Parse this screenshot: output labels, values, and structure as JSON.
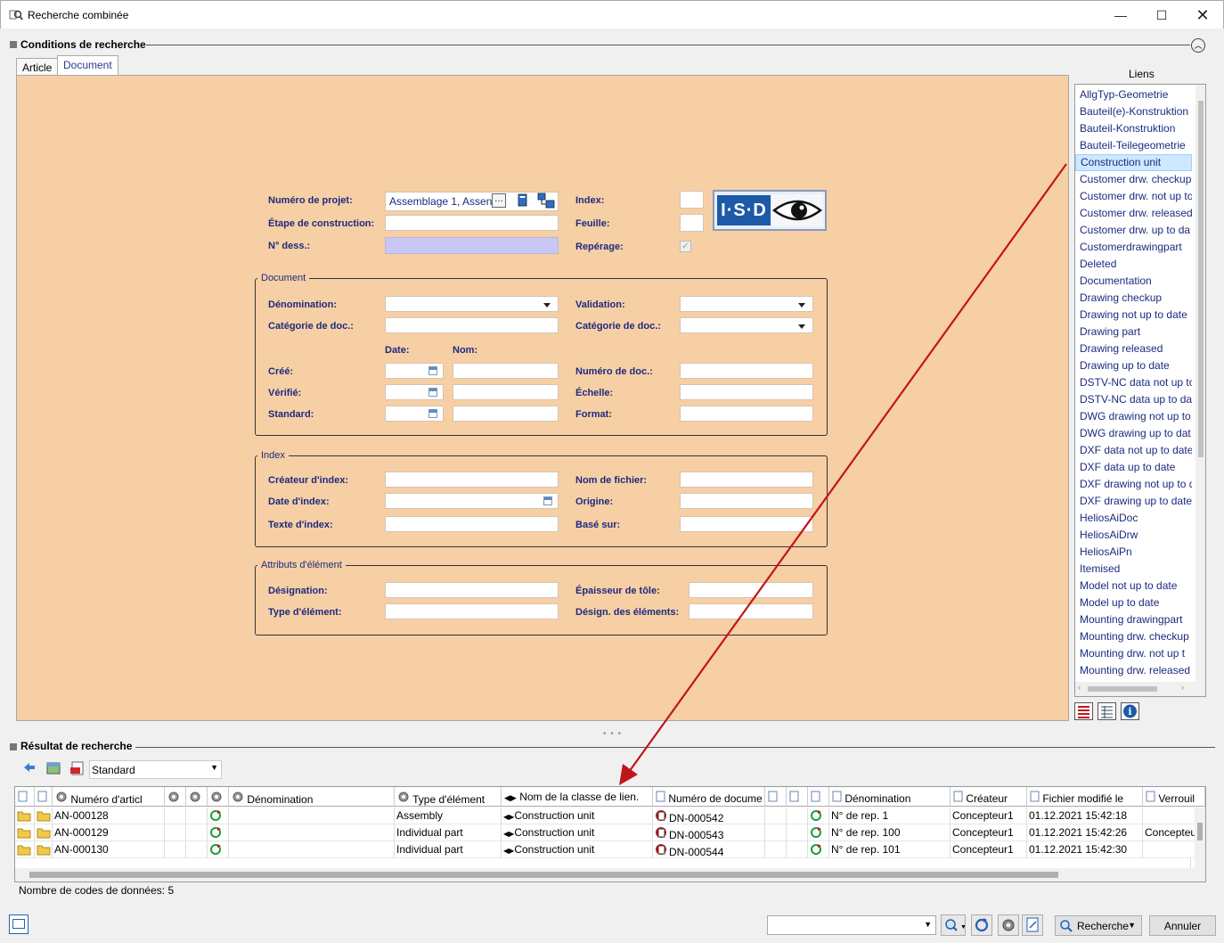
{
  "window": {
    "title": "Recherche combinée"
  },
  "search": {
    "section_title": "Conditions de recherche",
    "tabs": [
      "Article",
      "Document"
    ],
    "fields": {
      "project_label": "Numéro de projet:",
      "project_value": "Assemblage 1, Assen",
      "stage_label": "Étape de construction:",
      "drawing_no_label": "N° dess.:",
      "index_label": "Index:",
      "sheet_label": "Feuille:",
      "marking_label": "Repérage:"
    },
    "logo": "I·S·D",
    "doc_group": {
      "title": "Document",
      "denomination": "Dénomination:",
      "category": "Catégorie de doc.:",
      "validation": "Validation:",
      "category2": "Catégorie de doc.:",
      "date_hdr": "Date:",
      "name_hdr": "Nom:",
      "created": "Créé:",
      "checked": "Vérifié:",
      "standard": "Standard:",
      "doc_number": "Numéro de doc.:",
      "scale": "Échelle:",
      "format": "Format:"
    },
    "index_group": {
      "title": "Index",
      "creator": "Créateur d'index:",
      "date": "Date d'index:",
      "text": "Texte d'index:",
      "filename": "Nom de fichier:",
      "origin": "Origine:",
      "based_on": "Basé sur:"
    },
    "attr_group": {
      "title": "Attributs d'élément",
      "designation": "Désignation:",
      "elem_type": "Type d'élément:",
      "thickness": "Épaisseur de tôle:",
      "elem_desig": "Désign. des éléments:"
    }
  },
  "links": {
    "title": "Liens",
    "items": [
      "AllgTyp-Geometrie",
      "Bauteil(e)-Konstruktion",
      "Bauteil-Konstruktion",
      "Bauteil-Teilegeometrie",
      "Construction unit",
      "Customer drw. checkup",
      "Customer drw. not up to",
      "Customer drw. released",
      "Customer drw. up to da",
      "Customerdrawingpart",
      "Deleted",
      "Documentation",
      "Drawing checkup",
      "Drawing not up to date",
      "Drawing part",
      "Drawing released",
      "Drawing up to date",
      "DSTV-NC data not up to",
      "DSTV-NC data up to dat",
      "DWG drawing not up to",
      "DWG drawing up to dat",
      "DXF data not up to date",
      "DXF data up to date",
      "DXF drawing not up to d",
      "DXF drawing up to date",
      "HeliosAiDoc",
      "HeliosAiDrw",
      "HeliosAiPn",
      "Itemised",
      "Model not up to date",
      "Model up to date",
      "Mounting drawingpart",
      "Mounting drw. checkup",
      "Mounting drw. not up t",
      "Mounting drw. released"
    ],
    "selected": "Construction unit"
  },
  "results": {
    "section_title": "Résultat de recherche",
    "view": "Standard",
    "columns": [
      "Numéro d'articl",
      "Dénomination",
      "Type d'élément",
      "Nom de la classe de lien.",
      "Numéro de docume",
      "Dénomination",
      "Créateur",
      "Fichier modifié le",
      "Verrouil"
    ],
    "rows": [
      {
        "num": "AN-000128",
        "type": "Assembly",
        "cls": "Construction unit",
        "doc": "DN-000542",
        "den": "N° de rep. 1",
        "creator": "Concepteur1",
        "mod": "01.12.2021 15:42:18",
        "lock": ""
      },
      {
        "num": "AN-000129",
        "type": "Individual part",
        "cls": "Construction unit",
        "doc": "DN-000543",
        "den": "N° de rep. 100",
        "creator": "Concepteur1",
        "mod": "01.12.2021 15:42:26",
        "lock": "Concepteur"
      },
      {
        "num": "AN-000130",
        "type": "Individual part",
        "cls": "Construction unit",
        "doc": "DN-000544",
        "den": "N° de rep. 101",
        "creator": "Concepteur1",
        "mod": "01.12.2021 15:42:30",
        "lock": ""
      }
    ],
    "count_text": "Nombre de codes de données: 5"
  },
  "footer": {
    "search_btn": "Recherche",
    "cancel_btn": "Annuler"
  },
  "colors": {
    "form_bg": "#f7cfa5",
    "label": "#1c2a80",
    "arrow": "#c0161b"
  }
}
